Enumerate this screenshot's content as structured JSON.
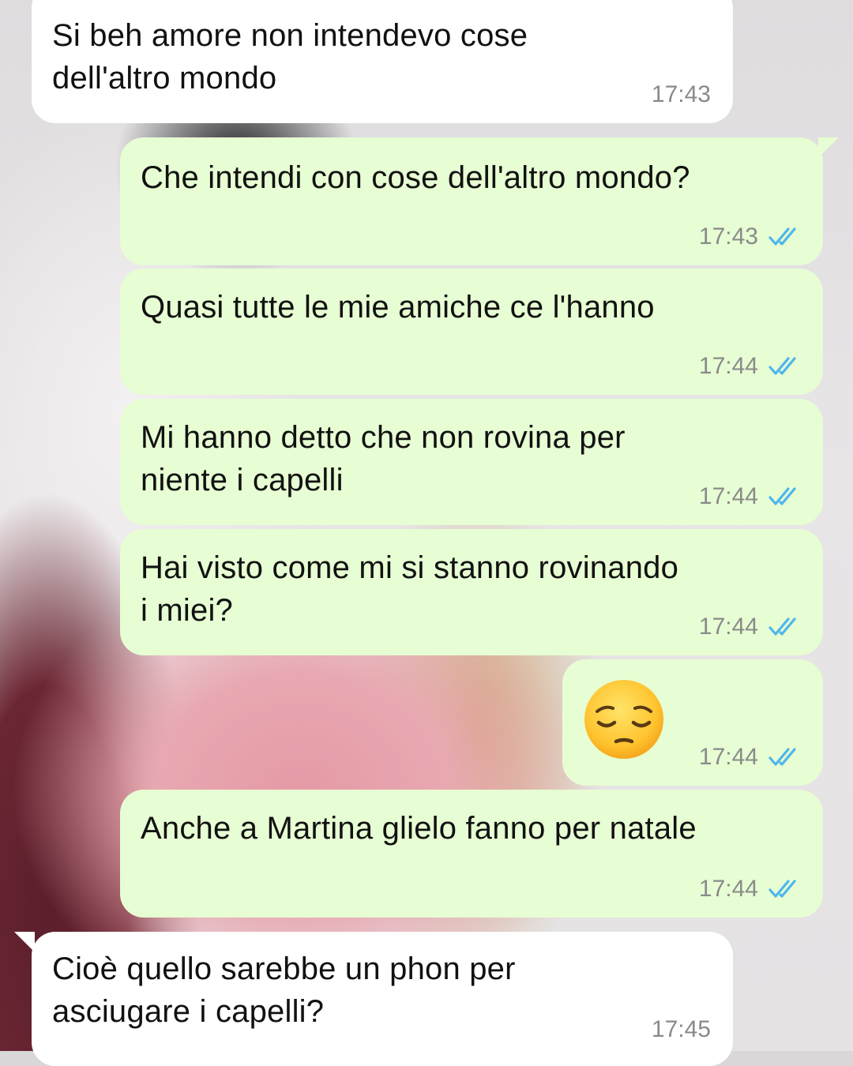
{
  "messages": [
    {
      "direction": "incoming",
      "text": "Si beh amore non intendevo cose\ndell'altro mondo",
      "time": "17:43"
    },
    {
      "direction": "outgoing",
      "text": "Che intendi con cose dell'altro mondo?",
      "time": "17:43",
      "status": "read"
    },
    {
      "direction": "outgoing",
      "text": "Quasi tutte le mie amiche ce l'hanno",
      "time": "17:44",
      "status": "read"
    },
    {
      "direction": "outgoing",
      "text": "Mi hanno detto che non rovina per\nniente i capelli",
      "time": "17:44",
      "status": "read"
    },
    {
      "direction": "outgoing",
      "text": "Hai visto come mi si stanno rovinando\ni miei?",
      "time": "17:44",
      "status": "read"
    },
    {
      "direction": "outgoing",
      "emoji": "pensive-face",
      "time": "17:44",
      "status": "read"
    },
    {
      "direction": "outgoing",
      "text": "Anche a Martina glielo fanno per natale",
      "time": "17:44",
      "status": "read"
    },
    {
      "direction": "incoming",
      "text": "Cioè quello sarebbe un phon per\nasciugare i capelli?",
      "time": "17:45"
    }
  ],
  "colors": {
    "incoming_bubble": "#ffffff",
    "outgoing_bubble": "#e7fdd3",
    "read_tick": "#4fb6ec",
    "timestamp": "#8a8a8a"
  },
  "icons": {
    "read_receipt": "double-check-icon",
    "emoji": "pensive-face-emoji"
  }
}
